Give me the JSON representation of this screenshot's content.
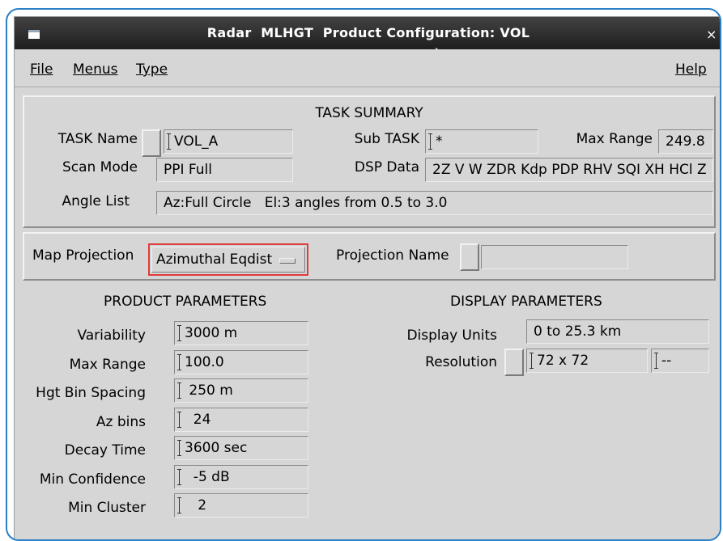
{
  "window": {
    "title": "Radar  MLHGT  Product Configuration: VOL",
    "close_glyph": "×"
  },
  "menubar": {
    "file": "File",
    "menus": "Menus",
    "type": "Type",
    "help": "Help"
  },
  "task_summary": {
    "heading": "TASK SUMMARY",
    "task_name_label": "TASK Name",
    "task_name_value": "VOL_A",
    "sub_task_label": "Sub TASK",
    "sub_task_value": "*",
    "max_range_label": "Max Range",
    "max_range_value": "249.8",
    "scan_mode_label": "Scan Mode",
    "scan_mode_value": "PPI Full",
    "dsp_data_label": "DSP Data",
    "dsp_data_value": "2Z V W ZDR Kdp PDP RHV SQI XH HCl Z",
    "angle_list_label": "Angle List",
    "angle_list_value": "Az:Full Circle   El:3 angles from 0.5 to 3.0"
  },
  "projection": {
    "map_projection_label": "Map Projection",
    "map_projection_value": "Azimuthal Eqdist",
    "projection_name_label": "Projection Name",
    "projection_name_value": ""
  },
  "product_parameters": {
    "heading": "PRODUCT PARAMETERS",
    "rows": [
      {
        "label": "Variability",
        "value": "3000 m"
      },
      {
        "label": "Max Range",
        "value": "100.0"
      },
      {
        "label": "Hgt Bin Spacing",
        "value": " 250 m"
      },
      {
        "label": "Az bins",
        "value": "  24"
      },
      {
        "label": "Decay Time",
        "value": "3600 sec"
      },
      {
        "label": "Min Confidence",
        "value": "  -5 dB"
      },
      {
        "label": "Min Cluster",
        "value": "   2"
      }
    ]
  },
  "display_parameters": {
    "heading": "DISPLAY PARAMETERS",
    "display_units_label": "Display Units",
    "display_units_value": "0 to 25.3 km",
    "resolution_label": "Resolution",
    "resolution_value": "72 x 72",
    "resolution_extra": "--"
  }
}
